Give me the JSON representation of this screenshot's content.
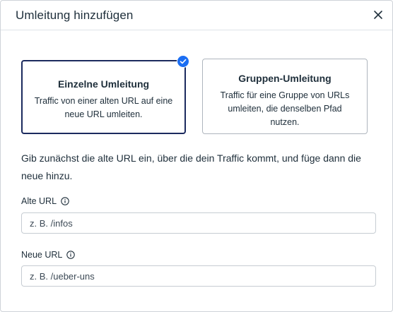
{
  "dialog": {
    "title": "Umleitung hinzufügen",
    "close_icon": "close-icon"
  },
  "options": [
    {
      "title": "Einzelne Umleitung",
      "description": "Traffic von einer alten URL auf eine neue URL umleiten.",
      "selected": true
    },
    {
      "title": "Gruppen-Umleitung",
      "description": "Traffic für eine Gruppe von URLs umleiten, die denselben Pfad nutzen.",
      "selected": false
    }
  ],
  "intro": "Gib zunächst die alte URL ein, über die dein Traffic kommt, und füge dann die neue hinzu.",
  "fields": {
    "old_url": {
      "label": "Alte URL",
      "value": "",
      "placeholder": "z. B. /infos"
    },
    "new_url": {
      "label": "Neue URL",
      "value": "",
      "placeholder": "z. B. /ueber-uns"
    }
  },
  "colors": {
    "selected_border": "#1b2a5e",
    "check_badge": "#1b6ef3",
    "text": "#20303c"
  }
}
